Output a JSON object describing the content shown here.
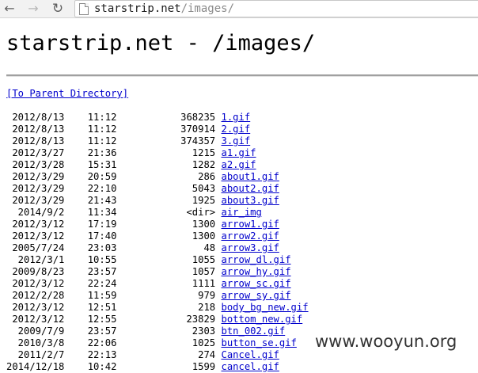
{
  "browser": {
    "back_icon": "arrow-left-icon",
    "forward_icon": "arrow-right-icon",
    "reload_icon": "reload-icon",
    "url_host": "starstrip.net",
    "url_path": "/images/"
  },
  "page": {
    "heading": "starstrip.net - /images/",
    "parent_link": "[To Parent Directory]"
  },
  "listing": [
    {
      "date": "2012/8/13",
      "time": "11:12",
      "size": "368235",
      "name": "1.gif"
    },
    {
      "date": "2012/8/13",
      "time": "11:12",
      "size": "370914",
      "name": "2.gif"
    },
    {
      "date": "2012/8/13",
      "time": "11:12",
      "size": "374357",
      "name": "3.gif"
    },
    {
      "date": "2012/3/27",
      "time": "21:36",
      "size": "1215",
      "name": "a1.gif"
    },
    {
      "date": "2012/3/28",
      "time": "15:31",
      "size": "1282",
      "name": "a2.gif"
    },
    {
      "date": "2012/3/29",
      "time": "20:59",
      "size": "286",
      "name": "about1.gif"
    },
    {
      "date": "2012/3/29",
      "time": "22:10",
      "size": "5043",
      "name": "about2.gif"
    },
    {
      "date": "2012/3/29",
      "time": "21:43",
      "size": "1925",
      "name": "about3.gif"
    },
    {
      "date": "2014/9/2",
      "time": "11:34",
      "size": "<dir>",
      "name": "air_img"
    },
    {
      "date": "2012/3/12",
      "time": "17:19",
      "size": "1300",
      "name": "arrow1.gif"
    },
    {
      "date": "2012/3/12",
      "time": "17:40",
      "size": "1300",
      "name": "arrow2.gif"
    },
    {
      "date": "2005/7/24",
      "time": "23:03",
      "size": "48",
      "name": "arrow3.gif"
    },
    {
      "date": "2012/3/1",
      "time": "10:55",
      "size": "1055",
      "name": "arrow_dl.gif"
    },
    {
      "date": "2009/8/23",
      "time": "23:57",
      "size": "1057",
      "name": "arrow_hy.gif"
    },
    {
      "date": "2012/3/12",
      "time": "22:24",
      "size": "1111",
      "name": "arrow_sc.gif"
    },
    {
      "date": "2012/2/28",
      "time": "11:59",
      "size": "979",
      "name": "arrow_sy.gif"
    },
    {
      "date": "2012/3/12",
      "time": "12:51",
      "size": "218",
      "name": "body_bg_new.gif"
    },
    {
      "date": "2012/3/12",
      "time": "12:55",
      "size": "23829",
      "name": "bottom_new.gif"
    },
    {
      "date": "2009/7/9",
      "time": "23:57",
      "size": "2303",
      "name": "btn_002.gif"
    },
    {
      "date": "2010/3/8",
      "time": "22:06",
      "size": "1025",
      "name": "button_se.gif"
    },
    {
      "date": "2011/2/7",
      "time": "22:13",
      "size": "274",
      "name": "Cancel.gif"
    },
    {
      "date": "2014/12/18",
      "time": "10:42",
      "size": "1599",
      "name": "cancel.gif"
    }
  ],
  "watermark": "www.wooyun.org"
}
